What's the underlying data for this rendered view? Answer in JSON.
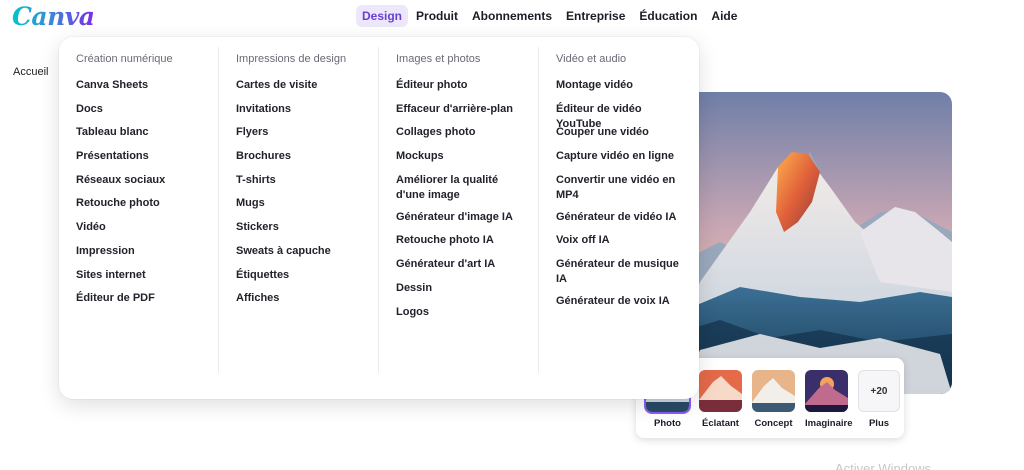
{
  "brand": {
    "logo_text": "Canva"
  },
  "topnav": {
    "items": [
      "Design",
      "Produit",
      "Abonnements",
      "Entreprise",
      "Éducation",
      "Aide"
    ],
    "active": "Design"
  },
  "page": {
    "home_link": "Accueil",
    "watermark": "Activer Windows"
  },
  "mega_menu": {
    "columns": [
      {
        "title": "Création numérique",
        "items": [
          "Canva Sheets",
          "Docs",
          "Tableau blanc",
          "Présentations",
          "Réseaux sociaux",
          "Retouche photo",
          "Vidéo",
          "Impression",
          "Sites internet",
          "Éditeur de PDF"
        ]
      },
      {
        "title": "Impressions de design",
        "items": [
          "Cartes de visite",
          "Invitations",
          "Flyers",
          "Brochures",
          "T-shirts",
          "Mugs",
          "Stickers",
          "Sweats à capuche",
          "Étiquettes",
          "Affiches"
        ]
      },
      {
        "title": "Images et photos",
        "items": [
          "Éditeur photo",
          "Effaceur d'arrière-plan",
          "Collages photo",
          "Mockups",
          "Améliorer la qualité d'une image",
          "Générateur d'image IA",
          "Retouche photo IA",
          "Générateur d'art IA",
          "Dessin",
          "Logos"
        ]
      },
      {
        "title": "Vidéo et audio",
        "items": [
          "Montage vidéo",
          "Éditeur de vidéo YouTube",
          "Couper une vidéo",
          "Capture vidéo en ligne",
          "Convertir une vidéo en MP4",
          "Générateur de vidéo IA",
          "Voix off IA",
          "Générateur de musique IA",
          "Générateur de voix IA"
        ]
      }
    ]
  },
  "style_chips": {
    "items": [
      "Photo",
      "Éclatant",
      "Concept",
      "Imaginaire"
    ],
    "selected": "Photo",
    "more_count": "+20",
    "more_label": "Plus"
  },
  "colors": {
    "accent": "#8b5cf6",
    "nav_active_bg": "#ece7fb",
    "nav_active_text": "#6b3fd4"
  }
}
